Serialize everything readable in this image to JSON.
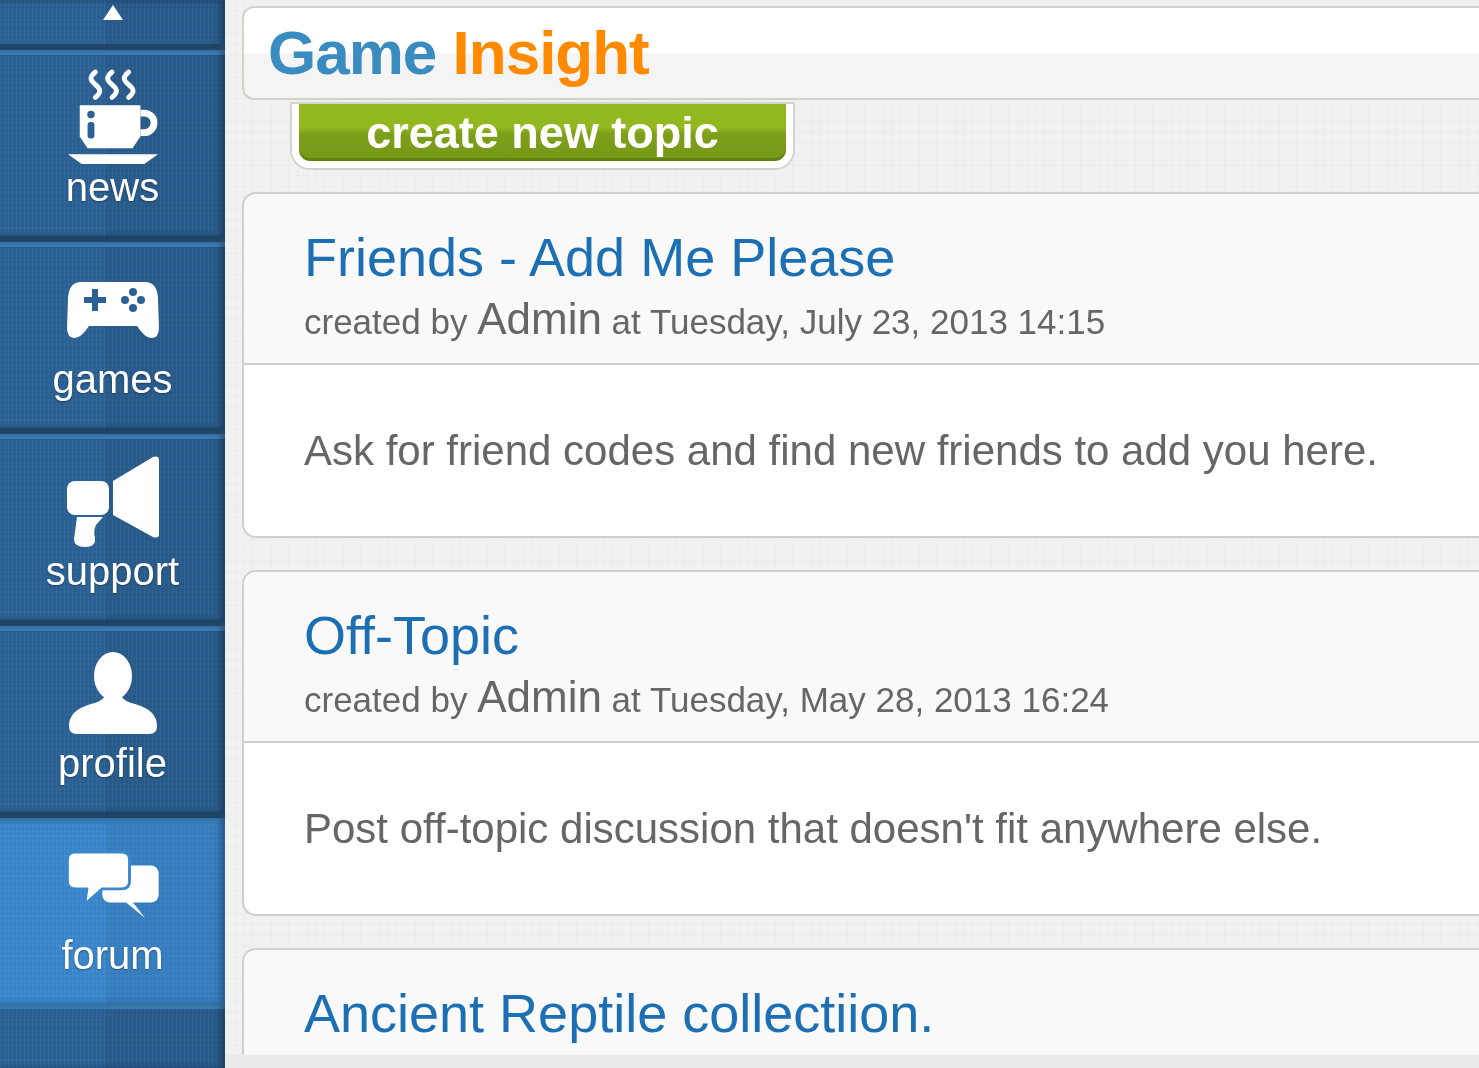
{
  "sidebar": {
    "items": [
      {
        "label": "news",
        "selected": false
      },
      {
        "label": "games",
        "selected": false
      },
      {
        "label": "support",
        "selected": false
      },
      {
        "label": "profile",
        "selected": false
      },
      {
        "label": "forum",
        "selected": true
      }
    ]
  },
  "header": {
    "logo": {
      "first_word": "Game",
      "second_word": "Insight"
    }
  },
  "create_topic_button": {
    "label": "create new topic"
  },
  "topics": [
    {
      "title": "Friends - Add Me Please",
      "created_by_label": "created by",
      "author": "Admin",
      "timestamp": "at Tuesday, July 23, 2013 14:15",
      "description": "Ask for friend codes and find new friends to add you here."
    },
    {
      "title": "Off-Topic",
      "created_by_label": "created by",
      "author": "Admin",
      "timestamp": "at Tuesday, May 28, 2013 16:24",
      "description": "Post off-topic discussion that doesn't fit anywhere else."
    },
    {
      "title": "Ancient Reptile collectiion."
    }
  ]
}
